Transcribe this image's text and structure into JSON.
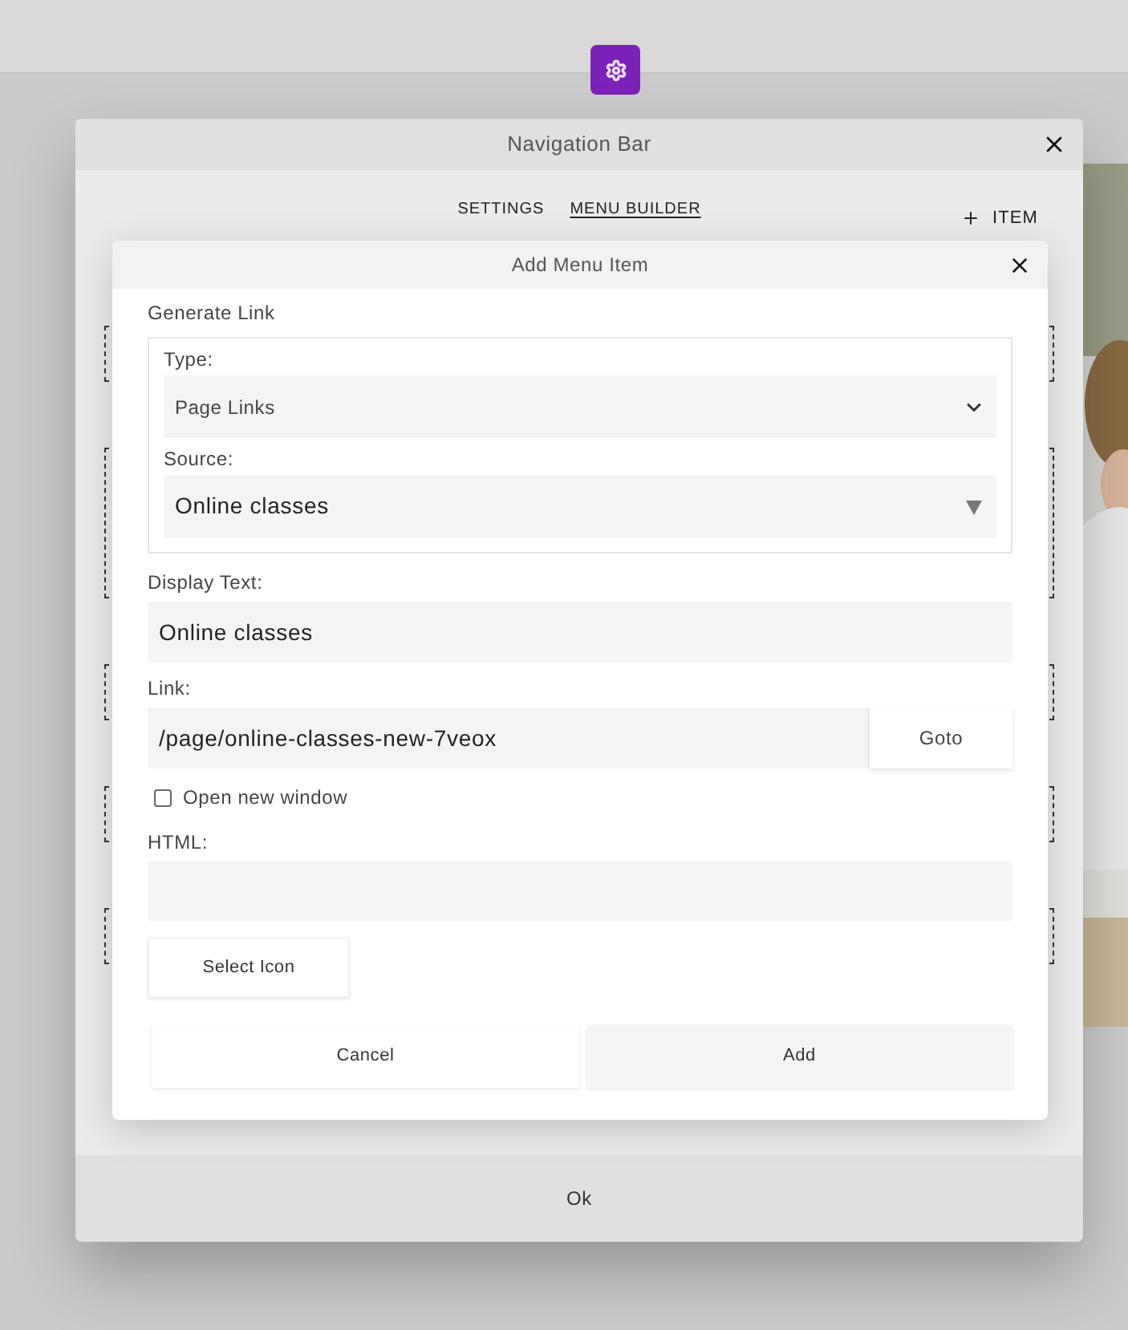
{
  "outer_dialog": {
    "title": "Navigation Bar",
    "tabs": [
      {
        "label": "SETTINGS",
        "selected": false
      },
      {
        "label": "MENU BUILDER",
        "selected": true
      }
    ],
    "add_item_button": "ITEM",
    "menu_items": [
      {
        "kind": "short"
      },
      {
        "kind": "tall"
      },
      {
        "kind": "short"
      },
      {
        "kind": "short"
      },
      {
        "kind": "short"
      }
    ],
    "ok_button": "Ok"
  },
  "dialog": {
    "title": "Add Menu Item",
    "section": "Generate Link",
    "type_label": "Type:",
    "type_value": "Page Links",
    "source_label": "Source:",
    "source_value": "Online classes",
    "display_text_label": "Display Text:",
    "display_text_value": "Online classes",
    "link_label": "Link:",
    "link_value": "/page/online-classes-new-7veox",
    "goto_button": "Goto",
    "open_new_window": {
      "label": "Open new window",
      "checked": false
    },
    "html_label": "HTML:",
    "select_icon_button": "Select Icon",
    "cancel_button": "Cancel",
    "add_button": "Add"
  }
}
